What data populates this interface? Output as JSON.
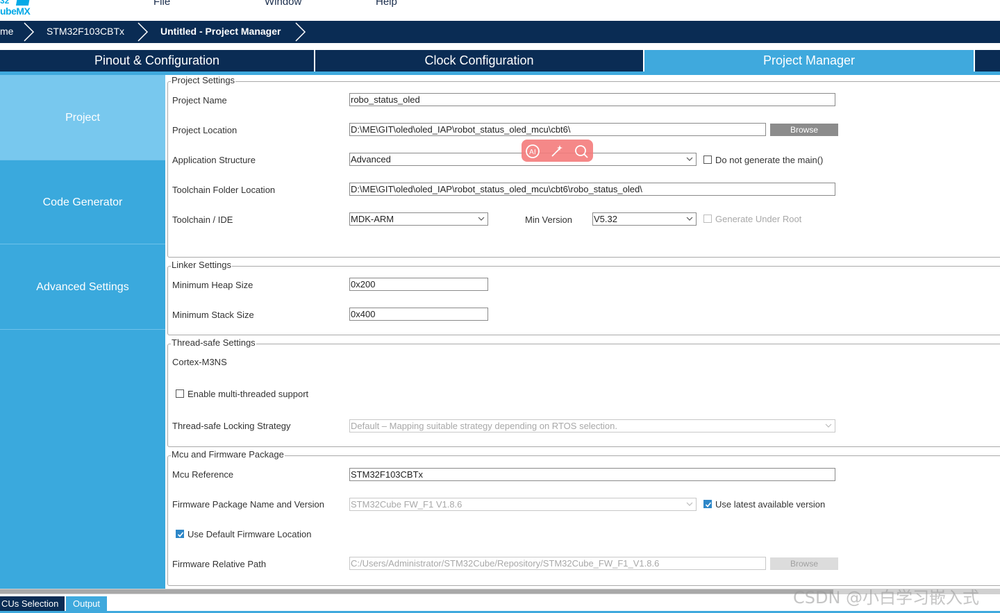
{
  "logo": {
    "line1": "32",
    "line2": "ubeMX"
  },
  "menu": [
    "File",
    "Window",
    "Help"
  ],
  "breadcrumb": [
    "me",
    "STM32F103CBTx",
    "Untitled - Project Manager"
  ],
  "tabs": [
    "Pinout & Configuration",
    "Clock Configuration",
    "Project Manager"
  ],
  "sidebar": [
    "Project",
    "Code Generator",
    "Advanced Settings"
  ],
  "project_settings": {
    "title": "Project Settings",
    "project_name_label": "Project Name",
    "project_name": "robo_status_oled",
    "project_location_label": "Project Location",
    "project_location": "D:\\ME\\GIT\\oled\\oled_IAP\\robot_status_oled_mcu\\cbt6\\",
    "browse": "Browse",
    "app_structure_label": "Application Structure",
    "app_structure": "Advanced",
    "no_main_label": "Do not generate the main()",
    "toolchain_folder_label": "Toolchain Folder Location",
    "toolchain_folder": "D:\\ME\\GIT\\oled\\oled_IAP\\robot_status_oled_mcu\\cbt6\\robo_status_oled\\",
    "toolchain_label": "Toolchain / IDE",
    "toolchain": "MDK-ARM",
    "min_version_label": "Min Version",
    "min_version": "V5.32",
    "generate_under_root": "Generate Under Root"
  },
  "linker_settings": {
    "title": "Linker Settings",
    "heap_label": "Minimum Heap Size",
    "heap": "0x200",
    "stack_label": "Minimum Stack Size",
    "stack": "0x400"
  },
  "thread_safe": {
    "title": "Thread-safe Settings",
    "core": "Cortex-M3NS",
    "multi_thread_label": "Enable multi-threaded support",
    "locking_label": "Thread-safe Locking Strategy",
    "locking": "Default  –  Mapping suitable strategy depending on RTOS selection."
  },
  "mcu_fw": {
    "title": "Mcu and Firmware Package",
    "mcu_ref_label": "Mcu Reference",
    "mcu_ref": "STM32F103CBTx",
    "fw_label": "Firmware Package Name and Version",
    "fw": "STM32Cube FW_F1 V1.8.6",
    "use_latest_label": "Use latest available version",
    "use_default_label": "Use Default Firmware Location",
    "rel_path_label": "Firmware Relative Path",
    "rel_path": "C:/Users/Administrator/STM32Cube/Repository/STM32Cube_FW_F1_V1.8.6",
    "browse": "Browse"
  },
  "bottom_tabs": [
    "CUs Selection",
    "Output"
  ],
  "watermark": "CSDN @小白学习嵌入式",
  "colors": {
    "navy": "#0a2c54",
    "accent": "#3fa9dd",
    "sidebar_active": "#78c8ee"
  }
}
